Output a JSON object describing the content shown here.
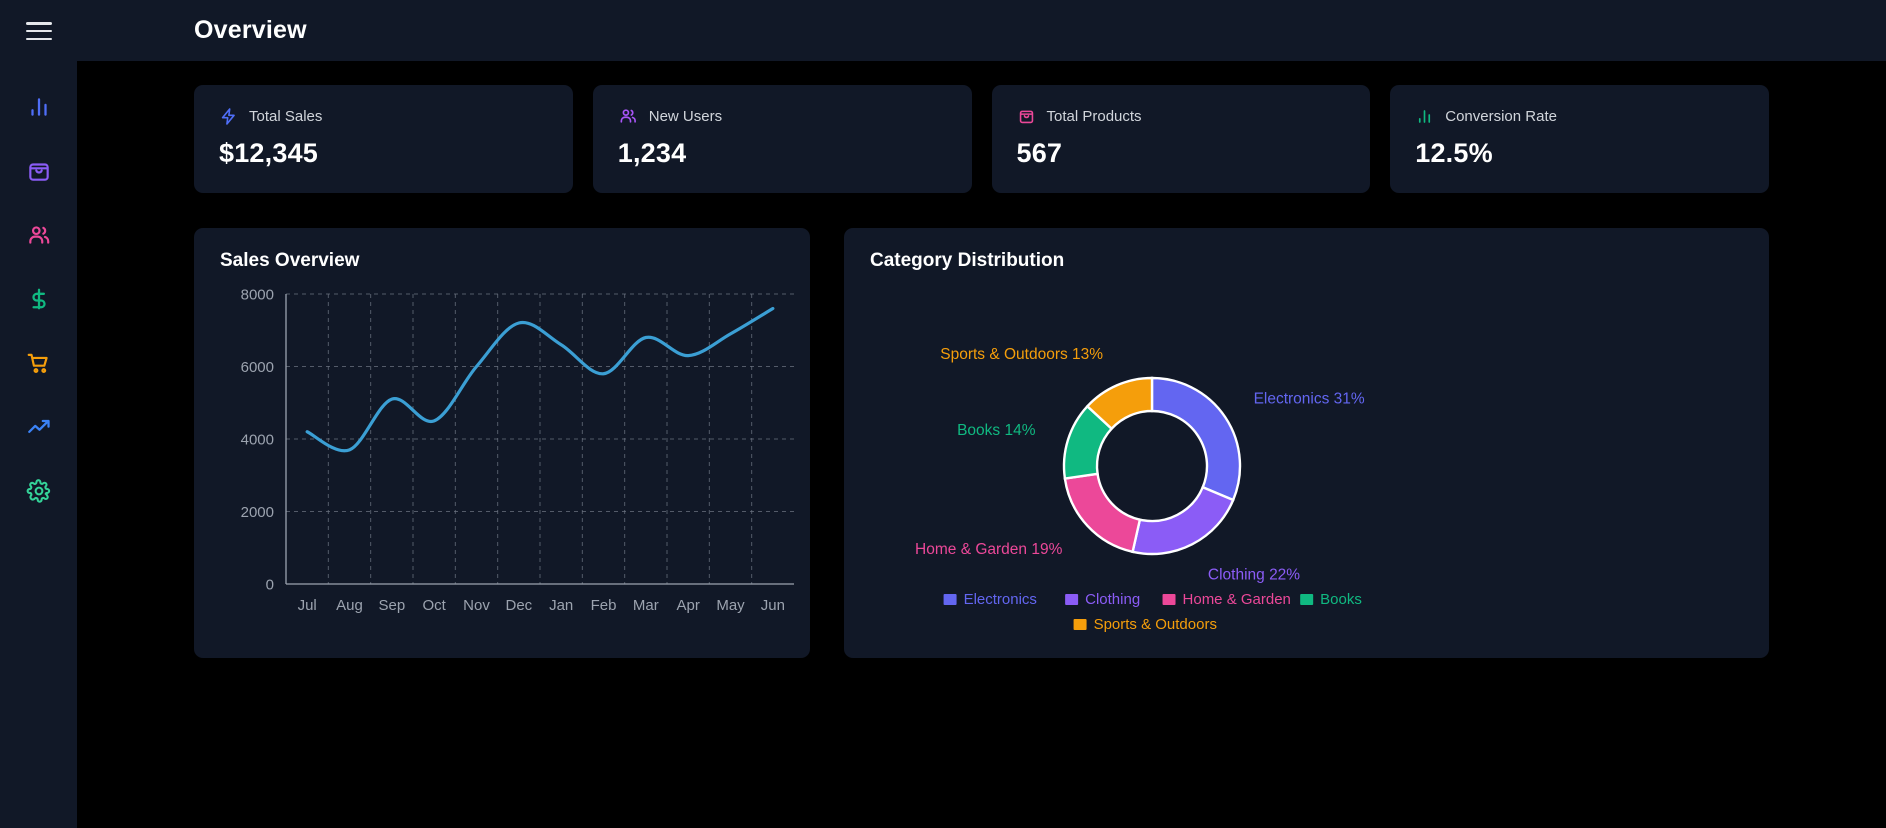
{
  "sidebar": {
    "menu_icon": "hamburger-menu-icon",
    "items": [
      {
        "icon": "bar-chart-icon",
        "name": "analytics",
        "color": "#4f6ef7"
      },
      {
        "icon": "shopping-bag-icon",
        "name": "products",
        "color": "#8b5cf6"
      },
      {
        "icon": "users-icon",
        "name": "users",
        "color": "#ec4899"
      },
      {
        "icon": "dollar-icon",
        "name": "revenue",
        "color": "#10b981"
      },
      {
        "icon": "cart-icon",
        "name": "orders",
        "color": "#f59e0b"
      },
      {
        "icon": "trending-up-icon",
        "name": "trends",
        "color": "#3b82f6"
      },
      {
        "icon": "gear-icon",
        "name": "settings",
        "color": "#34d399"
      }
    ]
  },
  "header": {
    "title": "Overview"
  },
  "stats": [
    {
      "label": "Total Sales",
      "value": "$12,345",
      "icon": "lightning-bolt-icon",
      "color": "#4f6ef7"
    },
    {
      "label": "New Users",
      "value": "1,234",
      "icon": "users-icon",
      "color": "#a855f7"
    },
    {
      "label": "Total Products",
      "value": "567",
      "icon": "shopping-bag-icon",
      "color": "#ec4899"
    },
    {
      "label": "Conversion Rate",
      "value": "12.5%",
      "icon": "bar-chart-icon",
      "color": "#10b981"
    }
  ],
  "panels": {
    "sales": {
      "title": "Sales Overview"
    },
    "category": {
      "title": "Category Distribution"
    }
  },
  "chart_data": [
    {
      "type": "line",
      "title": "Sales Overview",
      "xlabel": "",
      "ylabel": "",
      "categories": [
        "Jul",
        "Aug",
        "Sep",
        "Oct",
        "Nov",
        "Dec",
        "Jan",
        "Feb",
        "Mar",
        "Apr",
        "May",
        "Jun"
      ],
      "values": [
        4200,
        3700,
        5100,
        4500,
        6000,
        7200,
        6600,
        5800,
        6800,
        6300,
        6900,
        7600
      ],
      "ytick_labels": [
        "0",
        "2000",
        "4000",
        "6000",
        "8000"
      ],
      "yticks": [
        0,
        2000,
        4000,
        6000,
        8000
      ],
      "ylim": [
        0,
        8000
      ],
      "grid": true,
      "line_color": "#3b9fd4",
      "legend": "none"
    },
    {
      "type": "pie",
      "title": "Category Distribution",
      "donut": true,
      "labels": [
        "Electronics",
        "Clothing",
        "Home & Garden",
        "Books",
        "Sports & Outdoors"
      ],
      "values": [
        31,
        22,
        19,
        14,
        13
      ],
      "colors": [
        "#6366f1",
        "#8b5cf6",
        "#ec4899",
        "#10b981",
        "#f59e0b"
      ],
      "annotations": [
        "Electronics 31%",
        "Clothing 22%",
        "Home & Garden 19%",
        "Books 14%",
        "Sports & Outdoors 13%"
      ],
      "legend": "bottom"
    }
  ]
}
